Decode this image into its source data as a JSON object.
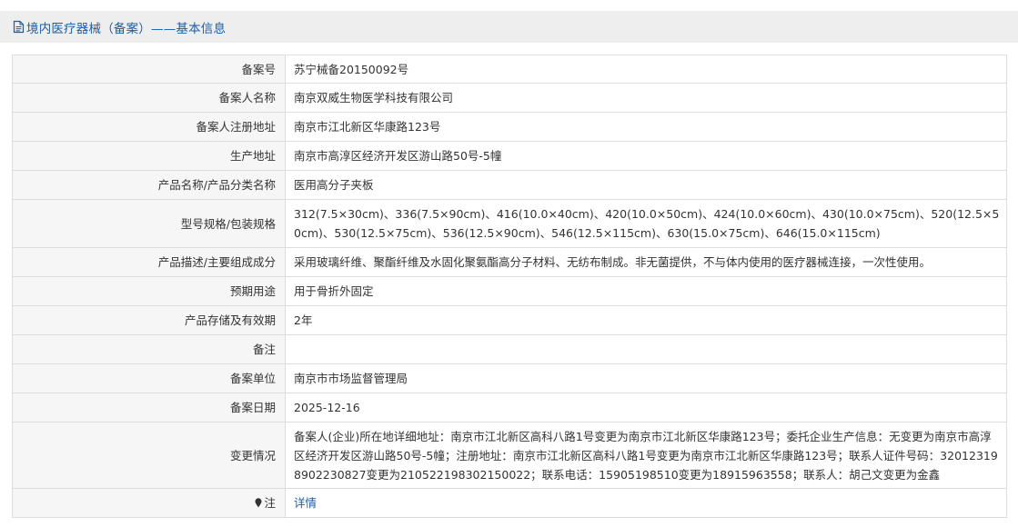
{
  "page": {
    "title": "境内医疗器械（备案）——基本信息",
    "doc_icon": "document-icon"
  },
  "rows": [
    {
      "label": "备案号",
      "value": "苏宁械备20150092号"
    },
    {
      "label": "备案人名称",
      "value": "南京双威生物医学科技有限公司"
    },
    {
      "label": "备案人注册地址",
      "value": "南京市江北新区华康路123号"
    },
    {
      "label": "生产地址",
      "value": "南京市高淳区经济开发区游山路50号-5幢"
    },
    {
      "label": "产品名称/产品分类名称",
      "value": "医用高分子夹板"
    },
    {
      "label": "型号规格/包装规格",
      "value": "312(7.5×30cm)、336(7.5×90cm)、416(10.0×40cm)、420(10.0×50cm)、424(10.0×60cm)、430(10.0×75cm)、520(12.5×50cm)、530(12.5×75cm)、536(12.5×90cm)、546(12.5×115cm)、630(15.0×75cm)、646(15.0×115cm)"
    },
    {
      "label": "产品描述/主要组成成分",
      "value": "采用玻璃纤维、聚酯纤维及水固化聚氨酯高分子材料、无纺布制成。非无菌提供，不与体内使用的医疗器械连接，一次性使用。"
    },
    {
      "label": "预期用途",
      "value": "用于骨折外固定"
    },
    {
      "label": "产品存储及有效期",
      "value": "2年"
    },
    {
      "label": "备注",
      "value": ""
    },
    {
      "label": "备案单位",
      "value": "南京市市场监督管理局"
    },
    {
      "label": "备案日期",
      "value": "2025-12-16"
    },
    {
      "label": "变更情况",
      "value": "备案人(企业)所在地详细地址：南京市江北新区高科八路1号变更为南京市江北新区华康路123号；委托企业生产信息：无变更为南京市高淳区经济开发区游山路50号-5幢；注册地址：南京市江北新区高科八路1号变更为南京市江北新区华康路123号；联系人证件号码：320123198902230827变更为210522198302150022；联系电话：15905198510变更为18915963558；联系人：胡己文变更为金鑫"
    }
  ],
  "note": {
    "label": "注",
    "icon": "pin-icon",
    "link_text": "详情"
  }
}
